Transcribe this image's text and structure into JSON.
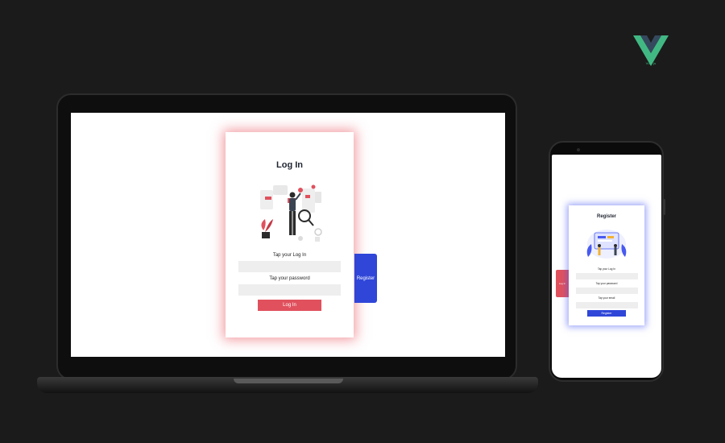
{
  "brand": {
    "caption": "Vue.js",
    "colors": {
      "green": "#41b883",
      "dark": "#35495e"
    }
  },
  "laptop": {
    "login_card": {
      "title": "Log In",
      "login_label": "Tap your Log In",
      "password_label": "Tap your password",
      "login_value": "",
      "password_value": "",
      "submit_label": "Log In",
      "glow_color": "#e84c57"
    },
    "register_tab_label": "Register"
  },
  "phone": {
    "register_card": {
      "title": "Register",
      "login_label": "Tap your Log In",
      "password_label": "Tap your password",
      "email_label": "Tap your email",
      "login_value": "",
      "password_value": "",
      "email_value": "",
      "submit_label": "Register",
      "glow_color": "#485af0"
    },
    "login_tab_label": "Log In"
  },
  "icons": [
    "vue-logo-icon",
    "login-illustration",
    "register-illustration"
  ]
}
